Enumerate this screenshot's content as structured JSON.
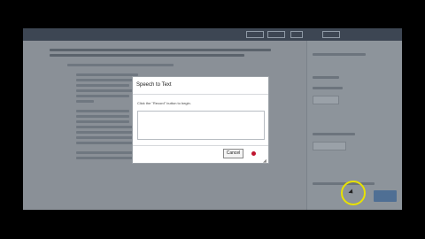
{
  "dialog": {
    "title": "Speech to Text",
    "instruction": "Click the \"Record\" button to begin.",
    "cancel_label": "Cancel",
    "record_icon": "record-icon",
    "record_color": "#c0152f",
    "text_value": ""
  },
  "colors": {
    "overlay": "#8a9097",
    "topbar": "#3d4653",
    "submit": "#4f6f94",
    "cursor_highlight": "#e8e200"
  }
}
